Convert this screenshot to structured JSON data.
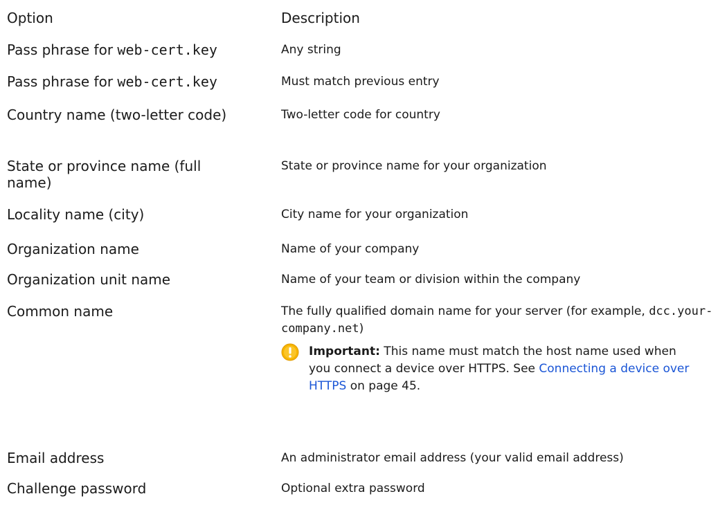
{
  "header": {
    "option": "Option",
    "description": "Description"
  },
  "rows": [
    {
      "option_pre": "Pass phrase for ",
      "option_code": "web-cert.key",
      "description": "Any string"
    },
    {
      "option_pre": "Pass phrase for ",
      "option_code": "web-cert.key",
      "description": "Must match previous entry"
    },
    {
      "option": "Country name (two-letter code)",
      "description": "Two-letter code for country"
    },
    {
      "option": "State or province name (full name)",
      "description": "State or province name for your organization"
    },
    {
      "option": "Locality name (city)",
      "description": "City name for your organization"
    },
    {
      "option": "Organization name",
      "description": "Name of your company"
    },
    {
      "option": "Organization unit name",
      "description": "Name of your team or division within the company"
    },
    {
      "option": "Common name",
      "description_pre": "The fully qualified domain name for your server (for example, ",
      "description_code": "dcc.your-company.net",
      "description_post": ")",
      "note": {
        "label": "Important:",
        "text_pre": " This name must match the host name used when you connect a device over HTTPS. See ",
        "link": "Connecting a device over HTTPS",
        "text_post": " on page 45."
      }
    },
    {
      "option": "Email address",
      "description": "An administrator email address (your valid email address)"
    },
    {
      "option": "Challenge password",
      "description": "Optional extra password"
    }
  ],
  "colors": {
    "link": "#1a55d6",
    "warning_icon": "#f5a800"
  },
  "icons": {
    "note": "warning-icon"
  }
}
